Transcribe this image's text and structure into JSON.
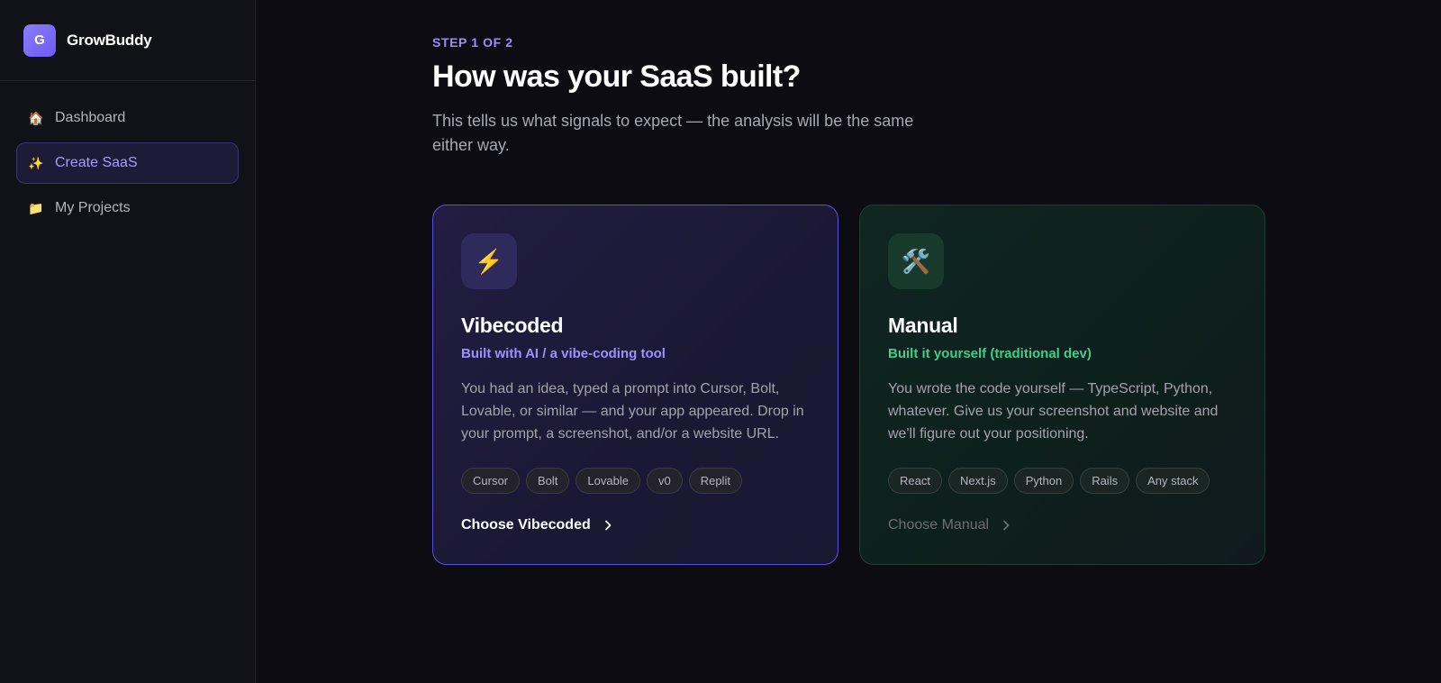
{
  "brand": {
    "logo_letter": "G",
    "name": "GrowBuddy"
  },
  "sidebar": {
    "items": [
      {
        "icon": "house-icon",
        "glyph": "🏠",
        "label": "Dashboard",
        "active": false
      },
      {
        "icon": "sparkles-icon",
        "glyph": "✨",
        "label": "Create SaaS",
        "active": true
      },
      {
        "icon": "folder-icon",
        "glyph": "📁",
        "label": "My Projects",
        "active": false
      }
    ]
  },
  "main": {
    "step": "STEP 1 OF 2",
    "title": "How was your SaaS built?",
    "subtitle": "This tells us what signals to expect — the analysis will be the same either way."
  },
  "cards": {
    "vibecoded": {
      "icon": "lightning-icon",
      "glyph": "⚡",
      "title": "Vibecoded",
      "tagline": "Built with AI / a vibe-coding tool",
      "description": "You had an idea, typed a prompt into Cursor, Bolt, Lovable, or similar — and your app appeared. Drop in your prompt, a screenshot, and/or a website URL.",
      "chips": [
        "Cursor",
        "Bolt",
        "Lovable",
        "v0",
        "Replit"
      ],
      "cta": "Choose Vibecoded",
      "accent": "#5b4ee0"
    },
    "manual": {
      "icon": "hammer-wrench-icon",
      "glyph": "🛠️",
      "title": "Manual",
      "tagline": "Built it yourself (traditional dev)",
      "description": "You wrote the code yourself — TypeScript, Python, whatever. Give us your screenshot and website and we'll figure out your positioning.",
      "chips": [
        "React",
        "Next.js",
        "Python",
        "Rails",
        "Any stack"
      ],
      "cta": "Choose Manual",
      "accent": "#3ccf8e"
    }
  }
}
